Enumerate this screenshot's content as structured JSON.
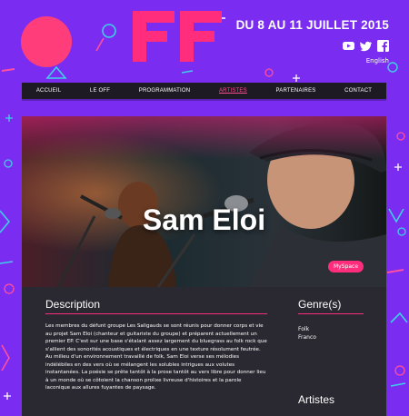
{
  "header": {
    "dates": "DU 8 AU 11 JUILLET 2015",
    "language": "English",
    "social": [
      "youtube-icon",
      "twitter-icon",
      "facebook-icon"
    ]
  },
  "nav": {
    "items": [
      "ACCUEIL",
      "LE OFF",
      "PROGRAMMATION",
      "ARTISTES",
      "PARTENAIRES",
      "CONTACT"
    ],
    "active": "ARTISTES"
  },
  "artist": {
    "name": "Sam Eloi",
    "link_label": "MySpace"
  },
  "description": {
    "heading": "Description",
    "text": "Les membres du défunt groupe Les Saligauds se sont réunis pour donner corps et vie au projet Sam Eloi (chanteur et guitariste du groupe) et préparent actuellement un premier EP. C'est sur une base s'étalant assez largement du bluegrass au folk rock que s'allient des sonorités acoustiques et électriques en une texture résolument feutrée. Au milieu d'un environnement travaillé de folk, Sam Eloi verse ses mélodies indélébiles en des vers où se mélangent les solubles intrigues aux volutes instantanées. La poésie se prête tantôt à la prose tantôt au vers libre pour donner lieu à un monde où se côtoient la chanson prolixe livreuse d'histoires et la parole laconique aux allures fuyantes de paysage."
  },
  "genres": {
    "heading": "Genre(s)",
    "items": [
      "Folk",
      "Franco"
    ]
  },
  "artists_section": {
    "heading": "Artistes"
  },
  "colors": {
    "background": "#7a2cf0",
    "accent": "#ff2d7c",
    "card": "#2a2830",
    "nav": "#1e1a24"
  }
}
